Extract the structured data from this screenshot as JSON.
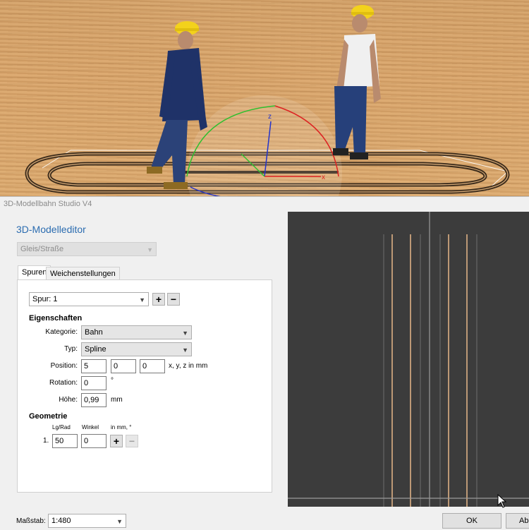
{
  "window": {
    "title": "3D-Modellbahn Studio V4"
  },
  "editor": {
    "heading": "3D-Modelleditor",
    "object_type": "Gleis/Straße",
    "tabs": [
      {
        "label": "Spuren"
      },
      {
        "label": "Weichenstellungen"
      }
    ],
    "track": {
      "label": "Spur: 1",
      "add_icon": "+",
      "remove_icon": "−"
    },
    "properties": {
      "heading": "Eigenschaften",
      "category_label": "Kategorie:",
      "category_value": "Bahn",
      "type_label": "Typ:",
      "type_value": "Spline",
      "position_label": "Position:",
      "position_x": "5",
      "position_y": "0",
      "position_z": "0",
      "position_unit": "x, y, z in mm",
      "rotation_label": "Rotation:",
      "rotation_value": "0",
      "rotation_unit": "°",
      "height_label": "Höhe:",
      "height_value": "0,99",
      "height_unit": "mm"
    },
    "geometry": {
      "heading": "Geometrie",
      "col_length": "Lg/Rad",
      "col_angle": "Winkel",
      "col_unit": "in mm, °",
      "rows": [
        {
          "index": "1.",
          "length": "50",
          "angle": "0"
        }
      ],
      "add_icon": "+",
      "remove_icon": "−"
    }
  },
  "footer": {
    "scale_label": "Maßstab:",
    "scale_value": "1:480",
    "ok_label": "OK",
    "cancel_label": "Abb"
  },
  "scene": {
    "gizmo_z": "z",
    "gizmo_x": "x"
  },
  "colors": {
    "accent": "#2b6cb0",
    "preview_bg": "#3c3c3c",
    "rail": "#e8b88a"
  }
}
